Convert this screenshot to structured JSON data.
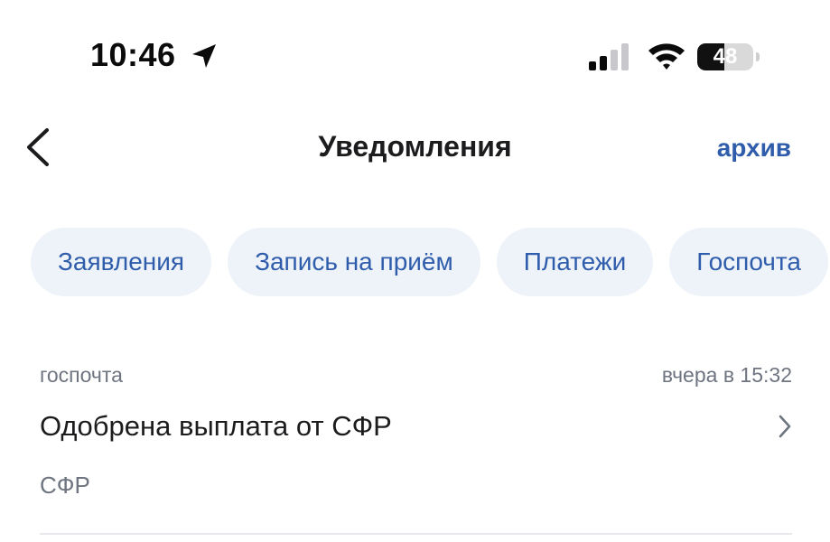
{
  "status_bar": {
    "time": "10:46",
    "battery_percent": "48",
    "battery_level": 0.48,
    "signal_bars_active": 2,
    "icons": [
      "location-arrow-icon",
      "cellular-signal-icon",
      "wifi-icon",
      "battery-icon"
    ]
  },
  "nav": {
    "title": "Уведомления",
    "back_icon": "chevron-left-icon",
    "archive_label": "архив"
  },
  "filters": [
    {
      "label": "Заявления"
    },
    {
      "label": "Запись на приём"
    },
    {
      "label": "Платежи"
    },
    {
      "label": "Госпочта"
    }
  ],
  "notifications": [
    {
      "source": "госпочта",
      "time": "вчера в 15:32",
      "title": "Одобрена выплата от СФР",
      "sender": "СФР"
    }
  ],
  "colors": {
    "accent": "#2f5dab",
    "chip_bg": "#eef3f9",
    "secondary_text": "#6e7480",
    "divider": "#e6e8ec"
  }
}
